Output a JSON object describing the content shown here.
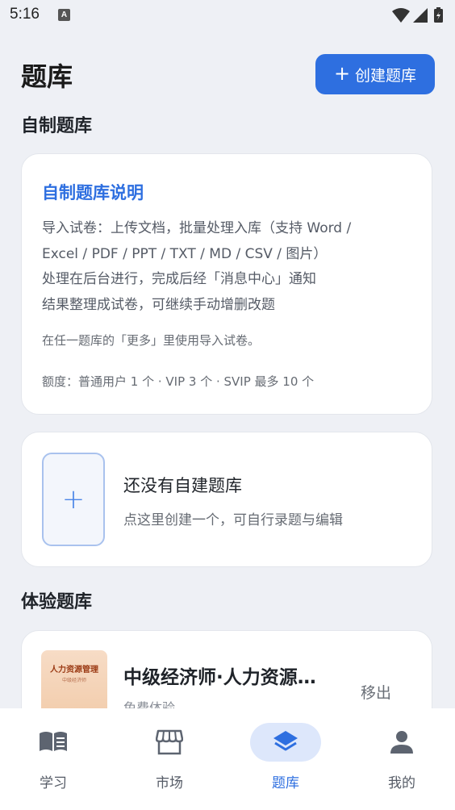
{
  "status_bar": {
    "time": "5:16",
    "notification_glyph": "A"
  },
  "header": {
    "title": "题库",
    "create_button": {
      "plus": "+",
      "label": "创建题库"
    }
  },
  "custom_section": {
    "title": "自制题库",
    "info_card": {
      "title": "自制题库说明",
      "lines": [
        "导入试卷：上传文档，批量处理入库（支持 Word /",
        "Excel / PDF / PPT / TXT / MD / CSV / 图片）",
        "处理在后台进行，完成后经「消息中心」通知",
        "结果整理成试卷，可继续手动增删改题"
      ],
      "tip": "在任一题库的「更多」里使用导入试卷。",
      "quota": "额度：普通用户 1 个 · VIP 3 个 · SVIP 最多 10 个"
    },
    "empty_card": {
      "plus": "+",
      "title": "还没有自建题库",
      "subtitle": "点这里创建一个，可自行录题与编辑"
    }
  },
  "trial_section": {
    "title": "体验题库",
    "items": [
      {
        "cover_title": "人力资源管理",
        "cover_subtitle": "中级经济师",
        "title": "中级经济师·人力资源管理",
        "subtitle": "免费体验",
        "action": "移出"
      }
    ]
  },
  "bottom_nav": {
    "active_index": 2,
    "items": [
      {
        "label": "学习",
        "icon": "book-icon"
      },
      {
        "label": "市场",
        "icon": "store-icon"
      },
      {
        "label": "题库",
        "icon": "layers-icon"
      },
      {
        "label": "我的",
        "icon": "person-icon"
      }
    ]
  },
  "colors": {
    "accent": "#2e6fe0",
    "background": "#eef0f5",
    "active_pill": "#dde7fb"
  }
}
